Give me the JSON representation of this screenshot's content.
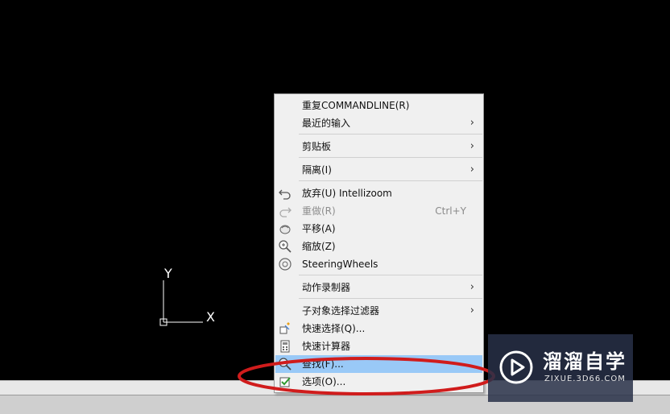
{
  "ucs": {
    "y_label": "Y",
    "x_label": "X"
  },
  "context_menu": {
    "items": [
      {
        "label": "重复COMMANDLINE(R)"
      },
      {
        "label": "最近的输入",
        "submenu_arrow": "›"
      },
      {
        "label": "剪贴板",
        "submenu_arrow": "›"
      },
      {
        "label": "隔离(I)",
        "submenu_arrow": "›"
      },
      {
        "label": "放弃(U) Intellizoom",
        "icon": "undo-icon"
      },
      {
        "label": "重做(R)",
        "shortcut": "Ctrl+Y",
        "icon": "redo-icon",
        "disabled": true
      },
      {
        "label": "平移(A)",
        "icon": "pan-icon"
      },
      {
        "label": "缩放(Z)",
        "icon": "zoom-icon"
      },
      {
        "label": "SteeringWheels",
        "icon": "steering-wheel-icon"
      },
      {
        "label": "动作录制器",
        "submenu_arrow": "›"
      },
      {
        "label": "子对象选择过滤器",
        "submenu_arrow": "›"
      },
      {
        "label": "快速选择(Q)...",
        "icon": "quick-select-icon"
      },
      {
        "label": "快速计算器",
        "icon": "calculator-icon"
      },
      {
        "label": "查找(F)...",
        "icon": "find-icon",
        "highlighted": true
      },
      {
        "label": "选项(O)...",
        "icon": "options-checkbox-icon"
      }
    ]
  },
  "annotation": {
    "color": "#d01c1c"
  },
  "watermark": {
    "name": "溜溜自学",
    "site": "ZIXUE.3D66.COM"
  },
  "colors": {
    "canvas": "#000000",
    "menu_bg": "#f0f0f0",
    "highlight": "#99c9f7"
  }
}
